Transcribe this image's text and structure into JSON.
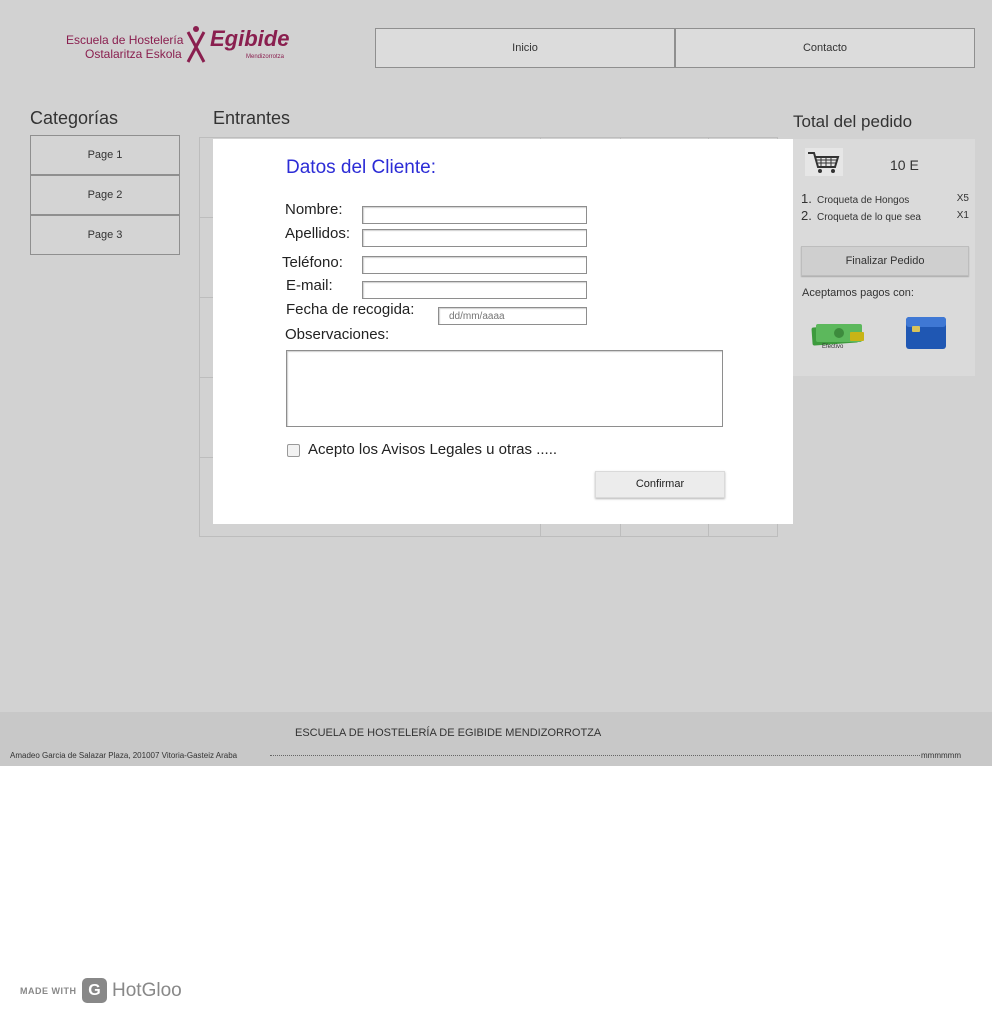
{
  "header": {
    "logo": {
      "line1": "Escuela de Hostelería",
      "line2": "Ostalaritza Eskola",
      "brand": "Egibide",
      "sub": "Mendizorrotza"
    },
    "nav": [
      {
        "label": "Inicio"
      },
      {
        "label": "Contacto"
      }
    ]
  },
  "sidebar": {
    "title": "Categorías",
    "items": [
      {
        "label": "Page 1"
      },
      {
        "label": "Page 2"
      },
      {
        "label": "Page 3"
      }
    ]
  },
  "main": {
    "title": "Entrantes"
  },
  "order": {
    "title": "Total del pedido",
    "total": "10 E",
    "items": [
      {
        "num": "1.",
        "name": "Croqueta de Hongos",
        "qty": "X5"
      },
      {
        "num": "2.",
        "name": "Croqueta de lo que sea",
        "qty": "X1"
      }
    ],
    "finalize_label": "Finalizar Pedido",
    "payments_label": "Aceptamos pagos con:",
    "cash_label": "Efectivo",
    "icons": {
      "cart": "shopping-cart-icon",
      "cash": "cash-icon",
      "card": "credit-card-icon"
    }
  },
  "modal": {
    "title": "Datos del Cliente:",
    "fields": {
      "nombre": {
        "label": "Nombre:",
        "value": ""
      },
      "apellidos": {
        "label": "Apellidos:",
        "value": ""
      },
      "telefono": {
        "label": "Teléfono:",
        "value": ""
      },
      "email": {
        "label": "E-mail:",
        "value": ""
      },
      "fecha": {
        "label": "Fecha de recogida:",
        "placeholder": "dd/mm/aaaa"
      },
      "observaciones": {
        "label": "Observaciones:",
        "value": ""
      }
    },
    "legal_label": "Acepto los Avisos Legales u otras .....",
    "legal_checked": false,
    "confirm_label": "Confirmar"
  },
  "footer": {
    "title": "ESCUELA DE HOSTELERÍA DE EGIBIDE MENDIZORROTZA",
    "address": "Amadeo Garcia de Salazar Plaza, 201007 Vitoria-Gasteiz Araba",
    "tail": "mmmmmm"
  },
  "badge": {
    "made_with": "MADE WITH",
    "brand": "HotGloo",
    "icon_letter": "G"
  },
  "colors": {
    "overlay_bg": "#d2d2d2",
    "modal_title": "#2c2cd6",
    "logo_brand": "#8a1f4f"
  }
}
